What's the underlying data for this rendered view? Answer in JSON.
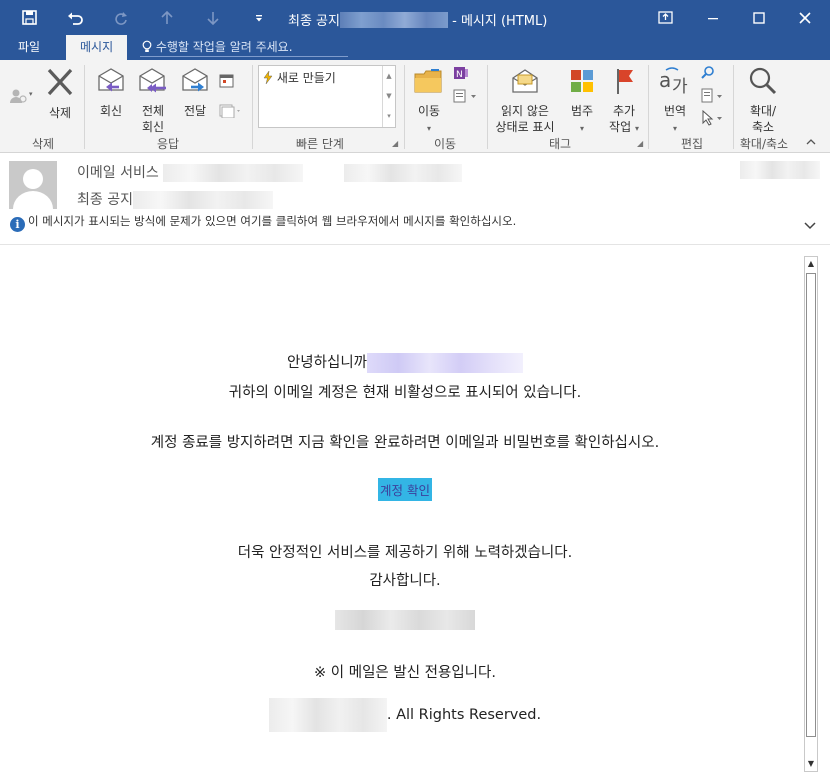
{
  "window": {
    "title_prefix": "최종 공지",
    "title_suffix": " - 메시지 (HTML)"
  },
  "quick_access": {
    "save_icon": "save-icon",
    "undo_icon": "undo-icon",
    "redo_icon": "redo-icon",
    "up_icon": "up-arrow-icon",
    "down_icon": "down-arrow-icon",
    "customize_icon": "customize-icon"
  },
  "tabs": [
    {
      "label": "파일"
    },
    {
      "label": "메시지"
    }
  ],
  "tell_me": {
    "placeholder": "수행할 작업을 알려 주세요."
  },
  "ribbon": {
    "delete_group": {
      "label": "삭제",
      "delete_label": "삭제"
    },
    "respond_group": {
      "label": "응답",
      "reply_label": "회신",
      "reply_all_label_1": "전체",
      "reply_all_label_2": "회신",
      "forward_label": "전달"
    },
    "quick_steps_group": {
      "label": "빠른 단계",
      "create_new_label": "새로 만들기"
    },
    "move_group": {
      "label": "이동",
      "move_label": "이동"
    },
    "tags_group": {
      "label": "태그",
      "unread_label_1": "읽지 않은",
      "unread_label_2": "상태로 표시",
      "categorize_label": "범주",
      "followup_label_1": "추가",
      "followup_label_2": "작업"
    },
    "edit_group": {
      "label": "편집",
      "translate_label": "번역"
    },
    "zoom_group": {
      "label": "확대/축소",
      "zoom_label_1": "확대/",
      "zoom_label_2": "축소"
    }
  },
  "header": {
    "sender_prefix": "이메일 서비스",
    "subject_prefix": "최종 공지",
    "info_text": "이 메시지가 표시되는 방식에 문제가 있으면 여기를 클릭하여 웹 브라우저에서 메시지를 확인하십시오."
  },
  "body": {
    "greeting": "안녕하십니까",
    "line1": "귀하의 이메일 계정은 현재 비활성으로 표시되어 있습니다.",
    "line2": "계정 종료를 방지하려면 지금 확인을 완료하려면 이메일과 비밀번호를 확인하십시오.",
    "confirm_button": "계정 확인",
    "line3": "더욱 안정적인 서비스를 제공하기 위해 노력하겠습니다.",
    "line4": "감사합니다.",
    "notice": "※ 이 메일은 발신 전용입니다.",
    "rights": ". All Rights Reserved."
  },
  "colors": {
    "titlebar": "#2b579a",
    "ribbon_bg": "#f3f3f3",
    "confirm_bg": "#33b5e5",
    "confirm_text": "#3c3f9c"
  }
}
